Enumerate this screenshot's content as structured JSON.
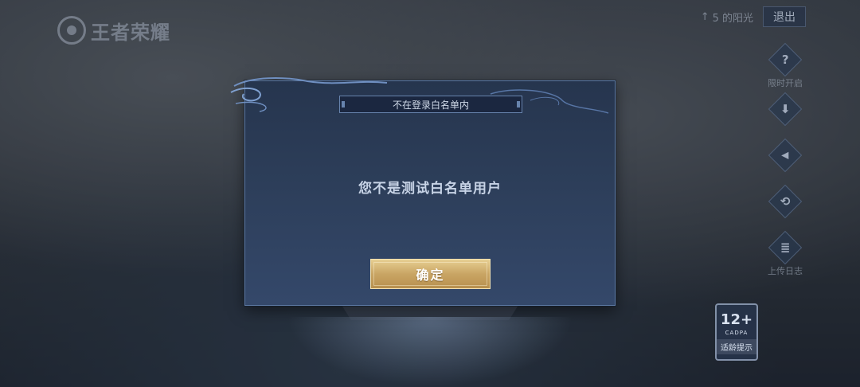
{
  "game": {
    "logo_text": "王者荣耀"
  },
  "top_right": {
    "sun_count": "5 的阳光",
    "exit_label": "退出"
  },
  "tools": [
    {
      "icon": "question-icon",
      "glyph": "?",
      "label": "限时开启"
    },
    {
      "icon": "download-icon",
      "glyph": "⬇",
      "label": ""
    },
    {
      "icon": "speaker-icon",
      "glyph": "🔊",
      "label": ""
    },
    {
      "icon": "repair-icon",
      "glyph": "⟲",
      "label": ""
    },
    {
      "icon": "document-icon",
      "glyph": "≣",
      "label": "上传日志"
    }
  ],
  "age_rating": {
    "number": "12+",
    "org": "CADPA",
    "label": "适龄提示"
  },
  "dialog": {
    "title": "不在登录白名单内",
    "message": "您不是测试白名单用户",
    "confirm_label": "确定"
  },
  "colors": {
    "dialog_bg": "#2c3d58",
    "dialog_border": "#5d7aa4",
    "confirm_gold": "#c9a564"
  }
}
